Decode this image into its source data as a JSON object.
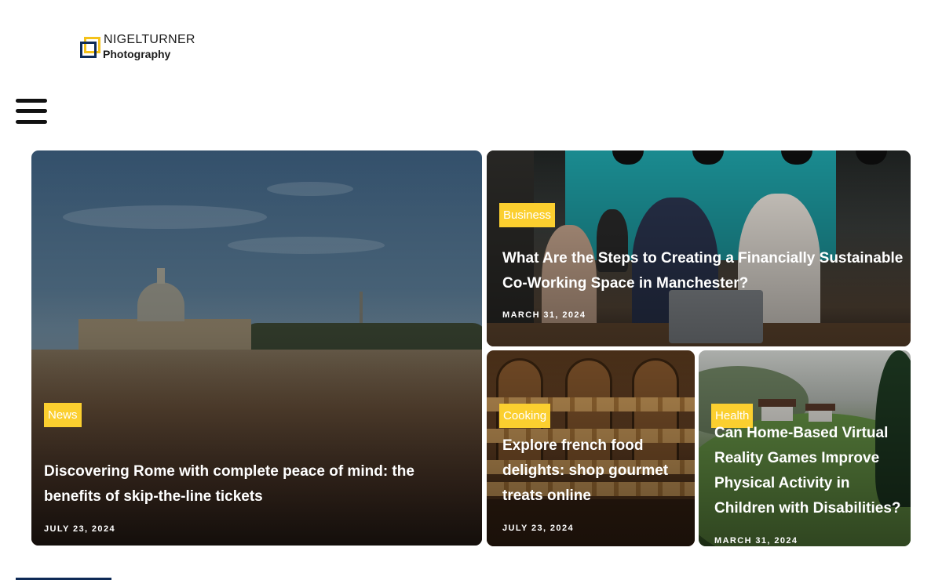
{
  "brand": {
    "line1": "NIGELTURNER",
    "line2": "Photography",
    "colors": {
      "yellow": "#f4c21b",
      "navy": "#0e2a56"
    }
  },
  "nav": {
    "menu_icon": "hamburger-menu-icon"
  },
  "featured": [
    {
      "category": "News",
      "title": "Discovering Rome with complete peace of mind: the benefits of skip-the-line tickets",
      "date": "JULY 23, 2024"
    },
    {
      "category": "Business",
      "title": "What Are the Steps to Creating a Financially Sustainable Co-Working Space in Manchester?",
      "date": "MARCH 31, 2024"
    },
    {
      "category": "Cooking",
      "title": "Explore french food delights: shop gourmet treats online",
      "date": "JULY 23, 2024"
    },
    {
      "category": "Health",
      "title": "Can Home-Based Virtual Reality Games Improve Physical Activity in Children with Disabilities?",
      "date": "MARCH 31, 2024"
    }
  ],
  "badge_color": "#fbcf2f"
}
